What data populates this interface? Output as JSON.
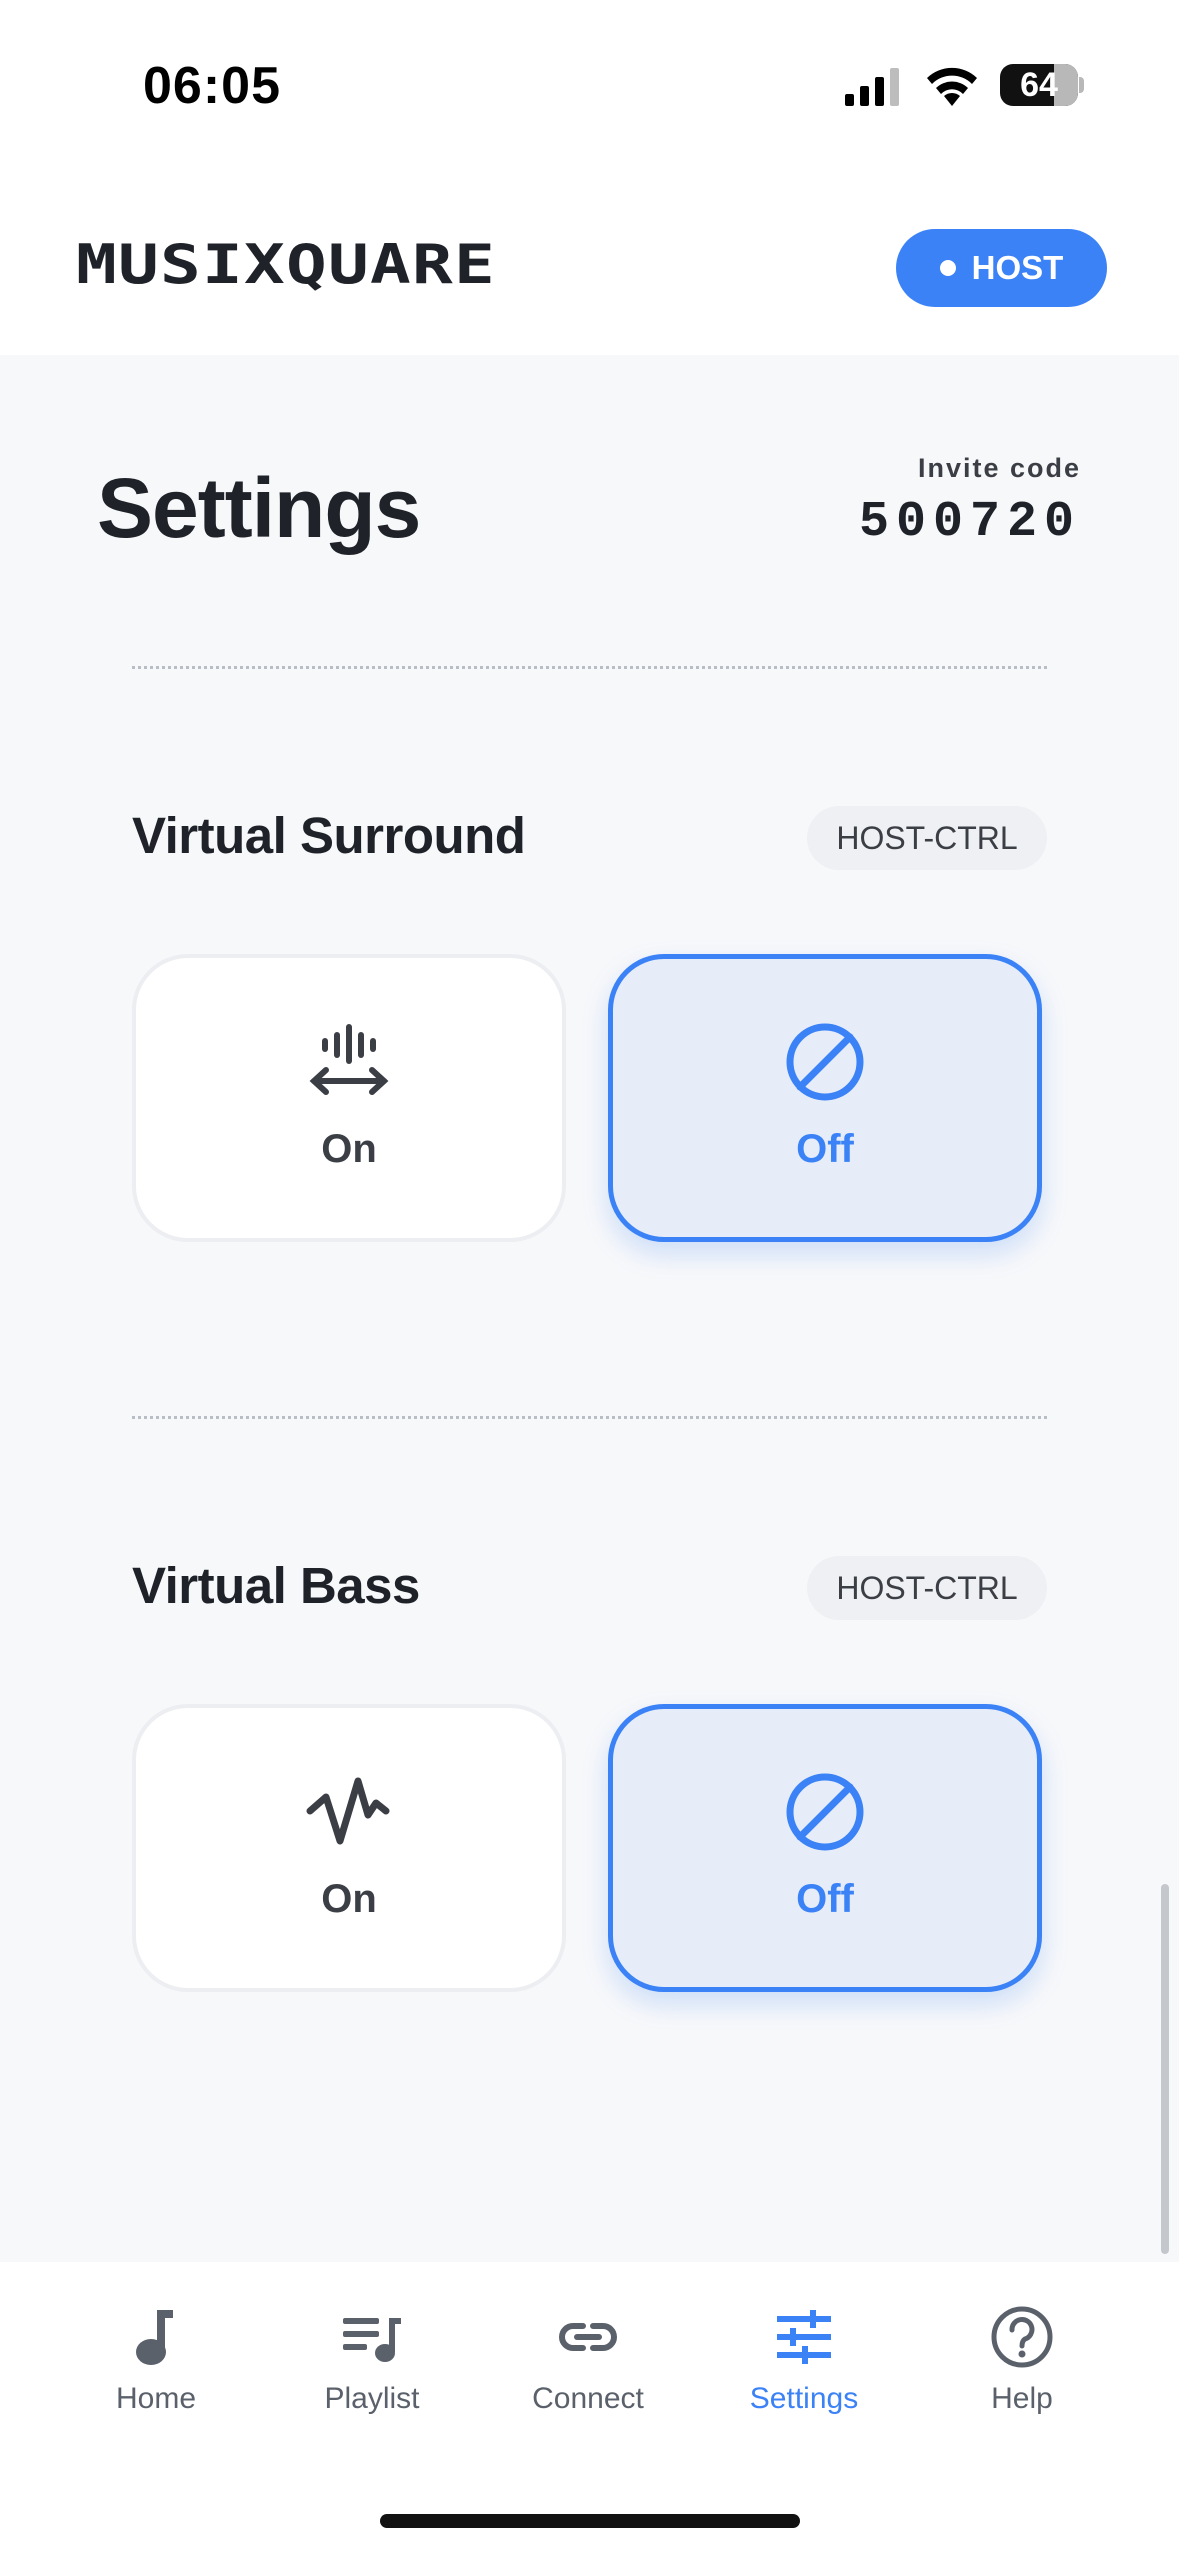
{
  "status_bar": {
    "time": "06:05",
    "battery": "64"
  },
  "header": {
    "logo_text": "MUSIXQUARE",
    "role_badge": "HOST"
  },
  "page": {
    "title": "Settings",
    "invite_label": "Invite code",
    "invite_code": "500720"
  },
  "settings": [
    {
      "title": "Virtual Surround",
      "badge": "HOST-CTRL",
      "options": [
        {
          "label": "On",
          "icon": "surround-icon",
          "selected": false
        },
        {
          "label": "Off",
          "icon": "disabled-icon",
          "selected": true
        }
      ]
    },
    {
      "title": "Virtual Bass",
      "badge": "HOST-CTRL",
      "options": [
        {
          "label": "On",
          "icon": "waveform-icon",
          "selected": false
        },
        {
          "label": "Off",
          "icon": "disabled-icon",
          "selected": true
        }
      ]
    }
  ],
  "nav": {
    "items": [
      {
        "label": "Home",
        "icon": "music-note-icon",
        "active": false
      },
      {
        "label": "Playlist",
        "icon": "playlist-icon",
        "active": false
      },
      {
        "label": "Connect",
        "icon": "link-icon",
        "active": false
      },
      {
        "label": "Settings",
        "icon": "sliders-icon",
        "active": true
      },
      {
        "label": "Help",
        "icon": "help-icon",
        "active": false
      }
    ]
  },
  "colors": {
    "accent": "#3b82f6",
    "selected_bg": "#e6edf9",
    "text": "#1f2329",
    "muted": "#5b616b",
    "background": "#f7f8fa"
  }
}
